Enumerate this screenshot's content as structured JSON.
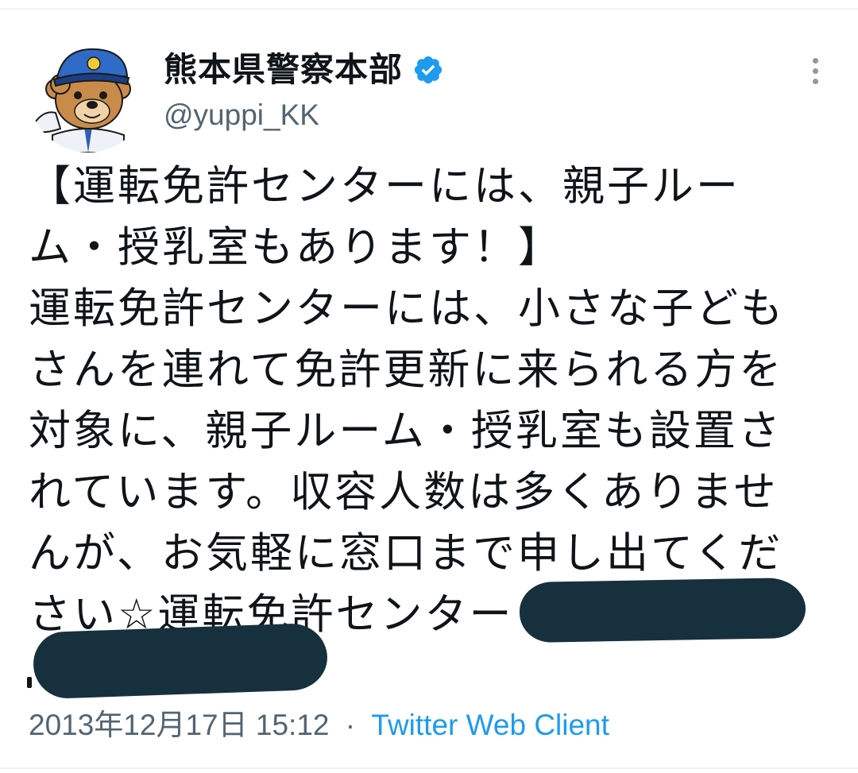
{
  "account": {
    "display_name": "熊本県警察本部",
    "handle": "@yuppi_KK",
    "verified_icon": "verified-badge-icon",
    "avatar": "police-bear-mascot-avatar"
  },
  "menu": {
    "icon": "more-vertical-icon"
  },
  "tweet": {
    "lines": [
      "【運転免許センターには、親子ルー",
      "ム・授乳室もあります！】",
      "運転免許センターには、小さな子ども",
      "さんを連れて免許更新に来られる方を",
      "対象に、親子ルーム・授乳室も設置さ",
      "れています。収容人数は多くありませ",
      "んが、お気軽に窓口まで申し出てくだ",
      "さい☆運転免許センター"
    ]
  },
  "meta": {
    "timestamp": "2013年12月17日 15:12",
    "separator": "·",
    "source": "Twitter Web Client"
  },
  "colors": {
    "text": "#0f1419",
    "secondary": "#536471",
    "link": "#1d9bf0",
    "verified": "#1d9bf0",
    "redaction": "#17303d"
  }
}
